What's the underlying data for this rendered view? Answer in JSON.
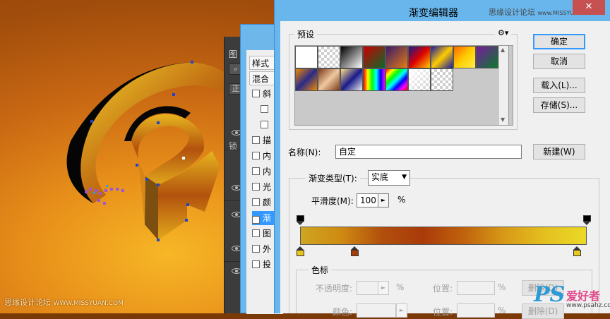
{
  "canvas": {
    "watermark_cn": "思缘设计论坛",
    "watermark_url": "WWW.MISSYUAN.COM"
  },
  "layers_panel": {
    "tab_label": "图",
    "lock_label": "锁",
    "icon_search": "search-icon",
    "filter_label": "正"
  },
  "layer_style": {
    "header": "样式",
    "blend_label": "混合",
    "items": [
      {
        "label": "斜",
        "checked": false,
        "indent": false
      },
      {
        "label": "",
        "checked": false,
        "indent": true
      },
      {
        "label": "",
        "checked": false,
        "indent": true
      },
      {
        "label": "描",
        "checked": false,
        "indent": false
      },
      {
        "label": "内",
        "checked": false,
        "indent": false
      },
      {
        "label": "内",
        "checked": false,
        "indent": false
      },
      {
        "label": "光",
        "checked": false,
        "indent": false
      },
      {
        "label": "颜",
        "checked": false,
        "indent": false
      },
      {
        "label": "渐",
        "checked": true,
        "indent": false,
        "selected": true
      },
      {
        "label": "图",
        "checked": false,
        "indent": false
      },
      {
        "label": "外",
        "checked": false,
        "indent": false
      },
      {
        "label": "投",
        "checked": false,
        "indent": false
      }
    ]
  },
  "gradient_editor": {
    "title": "渐变编辑器",
    "title_watermark": "思缘设计论坛",
    "title_watermark_url": "www.MISSYUAN.COM",
    "close_label": "✕",
    "presets_label": "预设",
    "presets_gear": "gear-icon",
    "buttons": {
      "ok": "确定",
      "cancel": "取消",
      "load": "载入(L)...",
      "save": "存储(S)...",
      "new": "新建(W)"
    },
    "name_label": "名称(N):",
    "name_value": "自定",
    "gradient_type_label": "渐变类型(T):",
    "gradient_type_value": "实底",
    "smoothness_label": "平滑度(M):",
    "smoothness_value": "100",
    "smoothness_unit": "%",
    "stops_label": "色标",
    "opacity_label": "不透明度:",
    "opacity_unit": "%",
    "location_label": "位置:",
    "location_unit": "%",
    "color_label": "颜色:",
    "delete_label": "删除(D)",
    "delete_label2": "删除(D)",
    "gradient_colors": [
      "#cfa521",
      "#cf8a12",
      "#b14f0c",
      "#a93b0a",
      "#c0620d",
      "#d79a17",
      "#e4c01f",
      "#ecd927"
    ],
    "color_stops": [
      {
        "color": "#e8c21f",
        "position": 0
      },
      {
        "color": "#a53d0a",
        "position": 19
      },
      {
        "color": "#e9c824",
        "position": 96.5
      }
    ],
    "opacity_stops": [
      {
        "position": 0
      },
      {
        "position": 100
      }
    ],
    "preset_swatches": [
      [
        "linear-gradient(135deg,#fff,#fff)",
        "checker",
        "linear-gradient(135deg,#000,#fff)",
        "linear-gradient(135deg,#c00,#0a6a2a)",
        "linear-gradient(135deg,#3a1a6a,#e47a14)",
        "linear-gradient(135deg,#1a1a8a,#d00,#fc0)",
        "linear-gradient(135deg,#1a1aa0,#fc0,#1a1aa0)",
        "linear-gradient(135deg,#f60,#fc0,#fe4)",
        "linear-gradient(135deg,#7a1aa0,#0a7a2a)"
      ],
      [
        "linear-gradient(135deg,#e80,#2a2a8a,#e80)",
        "linear-gradient(135deg,#7a3a1a,#f0c8a0,#7a3a1a)",
        "linear-gradient(135deg,#fd8,#1a1a8a,#eee)",
        "linear-gradient(90deg,#f00,#ff0,#0f0,#0ff,#00f,#f0f)",
        "linear-gradient(135deg,#f00,#ff0,#0f0,#0ff,#00f,#f0f,#f00)",
        "checker-light",
        "checker"
      ]
    ]
  },
  "brand_watermark": {
    "ps": "PS",
    "cn": "爱好者",
    "url": "www.psahz.com"
  }
}
